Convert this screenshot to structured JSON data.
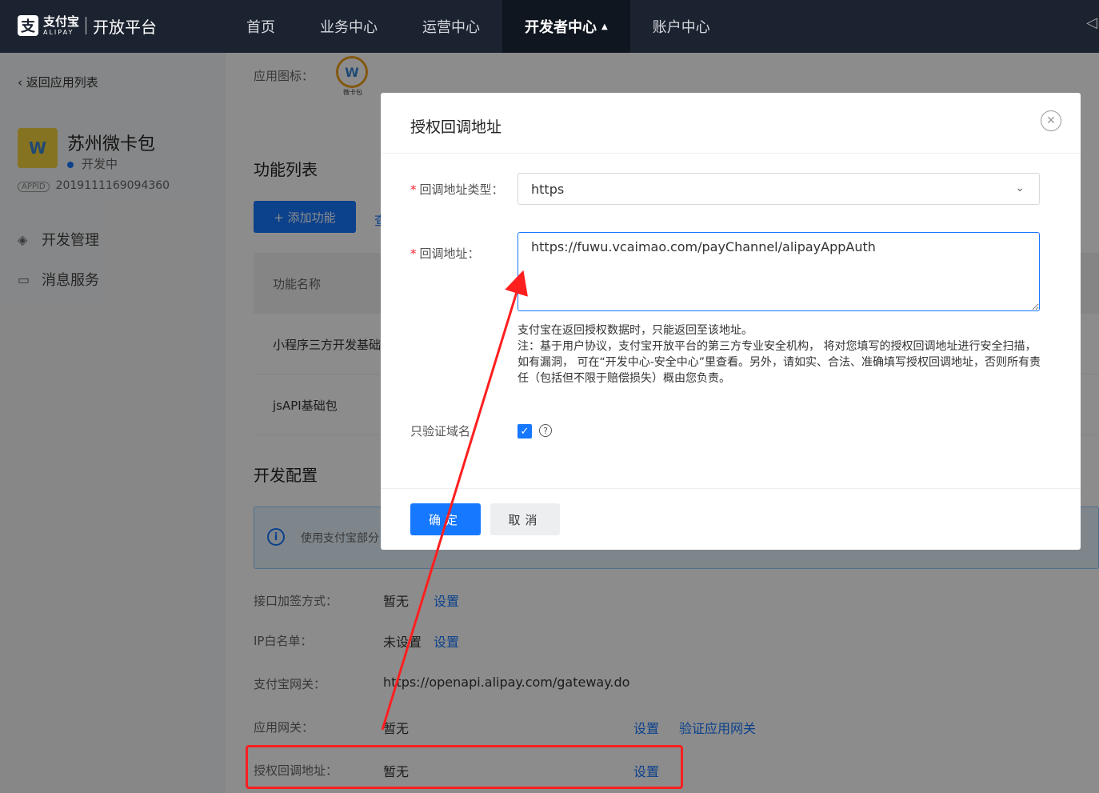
{
  "topbar": {
    "logo_mark": "支",
    "logo_cn": "支付宝",
    "logo_en": "ALIPAY",
    "platform": "开放平台",
    "nav": [
      "首页",
      "业务中心",
      "运营中心",
      "开发者中心",
      "账户中心"
    ],
    "active_nav": "开发者中心"
  },
  "sidebar": {
    "back": "返回应用列表",
    "app_name": "苏州微卡包",
    "app_status": "开发中",
    "appid_tag": "APPID",
    "appid": "2019111169094360",
    "items": [
      "开发管理",
      "消息服务"
    ],
    "icon_text": "W"
  },
  "main": {
    "app_icon_label": "应用图标：",
    "app_icon_text": "W",
    "app_icon_sub": "微卡包",
    "function_list_title": "功能列表",
    "add_button": "+ 添加功能",
    "add_button_trail": "查",
    "table_header": "功能名称",
    "rows": [
      "小程序三方开发基础",
      "jsAPI基础包"
    ],
    "dev_config_title": "开发配置",
    "info_text": "使用支付宝部分",
    "config": [
      {
        "label": "接口加签方式：",
        "value": "暂无",
        "action": "设置"
      },
      {
        "label": "IP白名单：",
        "value": "未设置",
        "action": "设置"
      },
      {
        "label": "支付宝网关：",
        "value": "https://openapi.alipay.com/gateway.do"
      },
      {
        "label": "应用网关：",
        "value": "暂无",
        "action": "设置",
        "action2": "验证应用网关"
      },
      {
        "label": "授权回调地址：",
        "value": "暂无",
        "action": "设置"
      }
    ]
  },
  "modal": {
    "title": "授权回调地址",
    "type_label": "回调地址类型：",
    "type_value": "https",
    "url_label": "回调地址：",
    "url_value": "https://fuwu.vcaimao.com/payChannel/alipayAppAuth",
    "help_line1": "支付宝在返回授权数据时，只能返回至该地址。",
    "help_line2": "注：基于用户协议，支付宝开放平台的第三方专业安全机构， 将对您填写的授权回调地址进行安全扫描，如有漏洞， 可在“开发中心-安全中心”里查看。另外，请如实、合法、准确填写授权回调地址，否则所有责任（包括但不限于赔偿损失）概由您负责。",
    "domain_only_label": "只验证域名",
    "domain_only_checked": true,
    "ok": "确定",
    "cancel": "取消"
  },
  "colors": {
    "primary": "#1677ff",
    "topbar": "#1c2330",
    "annotation": "#ff1f1f"
  }
}
